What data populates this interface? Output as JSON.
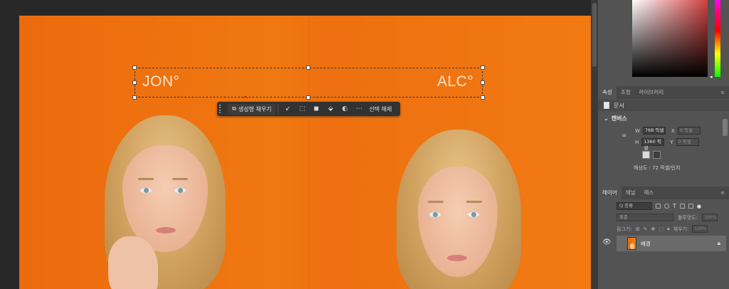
{
  "canvas": {
    "left_text": "JON°",
    "right_text": "ALC°",
    "taskbar": {
      "generate_label": "생성형 채우기",
      "deselect_label": "선택 해제"
    }
  },
  "properties_panel": {
    "tabs": [
      "속성",
      "조정",
      "라이브러리"
    ],
    "doc_label": "문서",
    "section_title": "캔버스",
    "width_label": "W",
    "width_value": "768 픽셀",
    "height_label": "H",
    "height_value": "1360 픽셀",
    "x_label": "X",
    "x_value": "0 픽셀",
    "y_label": "Y",
    "y_value": "0 픽셀",
    "resolution": "해상도 : 72 픽셀/인치"
  },
  "layers_panel": {
    "tabs": [
      "레이어",
      "채널",
      "패스"
    ],
    "search_placeholder": "Q 종류",
    "blend_mode": "표준",
    "opacity_label": "불투명도:",
    "opacity_value": "100%",
    "lock_label": "잠그기:",
    "fill_label": "채우기:",
    "fill_value": "100%",
    "layer_name": "배경"
  },
  "colors": {
    "accent_orange": "#f07810",
    "panel_bg": "#535353",
    "canvas_bg": "#282828"
  }
}
